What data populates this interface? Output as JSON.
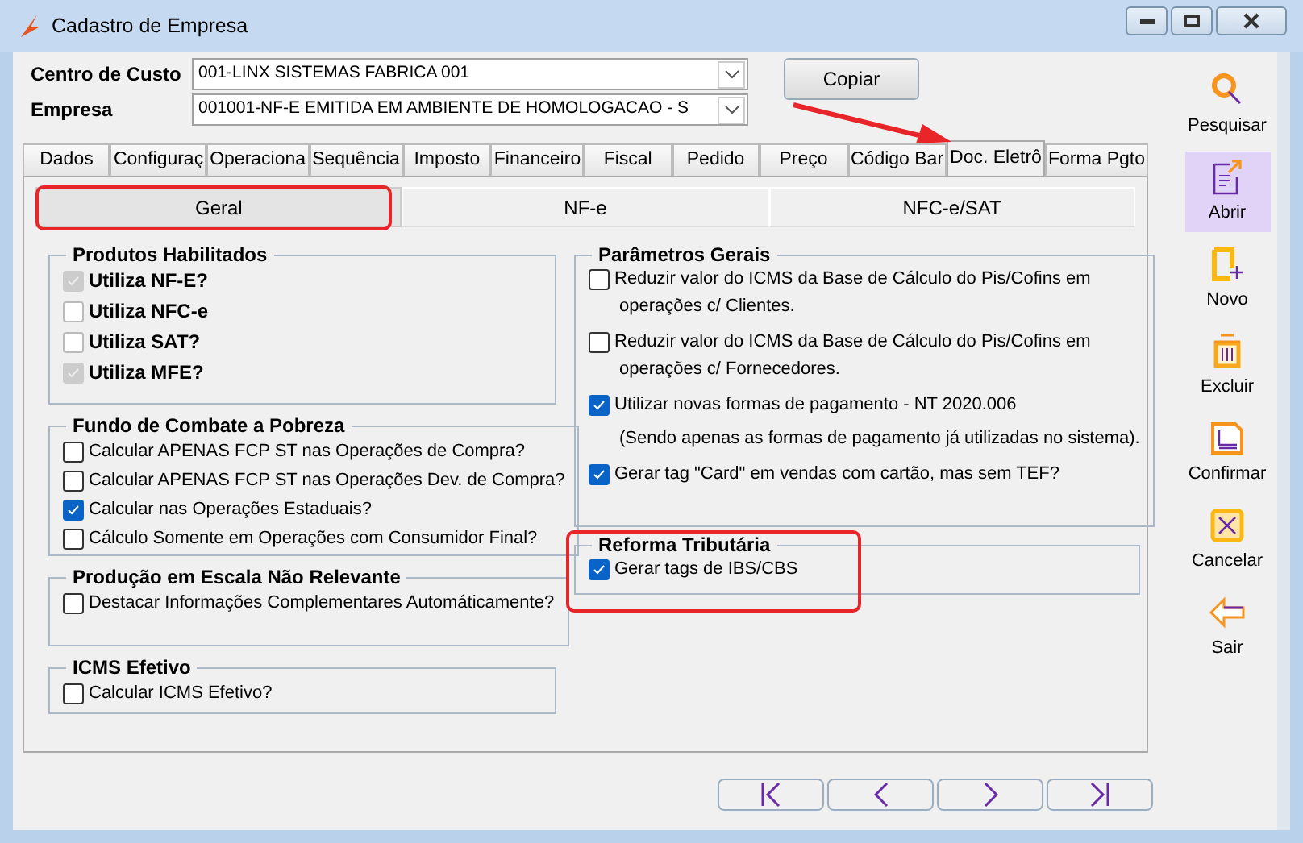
{
  "window": {
    "title": "Cadastro de Empresa"
  },
  "header": {
    "fields": [
      {
        "label": "Centro de Custo",
        "value": "001-LINX SISTEMAS FABRICA 001"
      },
      {
        "label": "Empresa",
        "value": "001001-NF-E EMITIDA EM AMBIENTE DE HOMOLOGACAO - S"
      }
    ],
    "copy_button": "Copiar"
  },
  "tabs": [
    {
      "label": "Dados",
      "selected": false
    },
    {
      "label": "Configuraç",
      "selected": false
    },
    {
      "label": "Operaciona",
      "selected": false
    },
    {
      "label": "Sequência",
      "selected": false
    },
    {
      "label": "Imposto",
      "selected": false
    },
    {
      "label": "Financeiro",
      "selected": false
    },
    {
      "label": "Fiscal",
      "selected": false
    },
    {
      "label": "Pedido",
      "selected": false
    },
    {
      "label": "Preço",
      "selected": false
    },
    {
      "label": "Código Bar",
      "selected": false
    },
    {
      "label": "Doc. Eletrô",
      "selected": true
    },
    {
      "label": "Forma Pgto",
      "selected": false
    }
  ],
  "subtabs": [
    {
      "label": "Geral",
      "selected": true
    },
    {
      "label": "NF-e",
      "selected": false
    },
    {
      "label": "NFC-e/SAT",
      "selected": false
    }
  ],
  "left_groups": [
    {
      "title": "Produtos Habilitados",
      "bold_items": true,
      "items": [
        {
          "label": "Utiliza NF-E?",
          "checked": true,
          "disabled": true
        },
        {
          "label": "Utiliza NFC-e",
          "checked": false,
          "disabled": true
        },
        {
          "label": "Utiliza SAT?",
          "checked": false,
          "disabled": true
        },
        {
          "label": "Utiliza MFE?",
          "checked": true,
          "disabled": true
        }
      ]
    },
    {
      "title": "Fundo de Combate a Pobreza",
      "bold_items": false,
      "items": [
        {
          "label": "Calcular APENAS FCP ST nas Operações de Compra?",
          "checked": false,
          "disabled": false
        },
        {
          "label": "Calcular APENAS FCP ST nas Operações Dev. de Compra?",
          "checked": false,
          "disabled": false
        },
        {
          "label": "Calcular nas Operações Estaduais?",
          "checked": true,
          "disabled": false
        },
        {
          "label": "Cálculo Somente em Operações com Consumidor Final?",
          "checked": false,
          "disabled": false
        }
      ]
    },
    {
      "title": "Produção em Escala Não Relevante",
      "bold_items": false,
      "items": [
        {
          "label": "Destacar Informações Complementares Automáticamente?",
          "checked": false,
          "disabled": false
        }
      ]
    },
    {
      "title": "ICMS Efetivo",
      "bold_items": false,
      "items": [
        {
          "label": "Calcular ICMS Efetivo?",
          "checked": false,
          "disabled": false
        }
      ]
    }
  ],
  "right_groups": [
    {
      "title": "Parâmetros Gerais",
      "items": [
        {
          "label": "Reduzir valor do ICMS da Base de Cálculo do Pis/Cofins em",
          "continuation": "operações c/ Clientes.",
          "checked": false
        },
        {
          "label": "Reduzir valor do ICMS da Base de Cálculo do Pis/Cofins em",
          "continuation": "operações c/ Fornecedores.",
          "checked": false
        },
        {
          "label": "Utilizar novas formas de pagamento - NT 2020.006",
          "continuation": "(Sendo apenas as formas de pagamento já utilizadas no sistema).",
          "checked": true
        },
        {
          "label": "Gerar tag \"Card\" em vendas com cartão, mas sem TEF?",
          "checked": true
        }
      ]
    },
    {
      "title": "Reforma Tributária",
      "items": [
        {
          "label": "Gerar tags de IBS/CBS",
          "checked": true
        }
      ]
    }
  ],
  "toolbar": [
    {
      "kind": "search",
      "label": "Pesquisar",
      "highlighted": false
    },
    {
      "kind": "open",
      "label": "Abrir",
      "highlighted": true
    },
    {
      "kind": "new",
      "label": "Novo",
      "highlighted": false
    },
    {
      "kind": "delete",
      "label": "Excluir",
      "highlighted": false
    },
    {
      "kind": "confirm",
      "label": "Confirmar",
      "highlighted": false
    },
    {
      "kind": "cancel",
      "label": "Cancelar",
      "highlighted": false
    },
    {
      "kind": "exit",
      "label": "Sair",
      "highlighted": false
    }
  ],
  "navigation": [
    {
      "kind": "first"
    },
    {
      "kind": "previous"
    },
    {
      "kind": "next"
    },
    {
      "kind": "last"
    }
  ]
}
